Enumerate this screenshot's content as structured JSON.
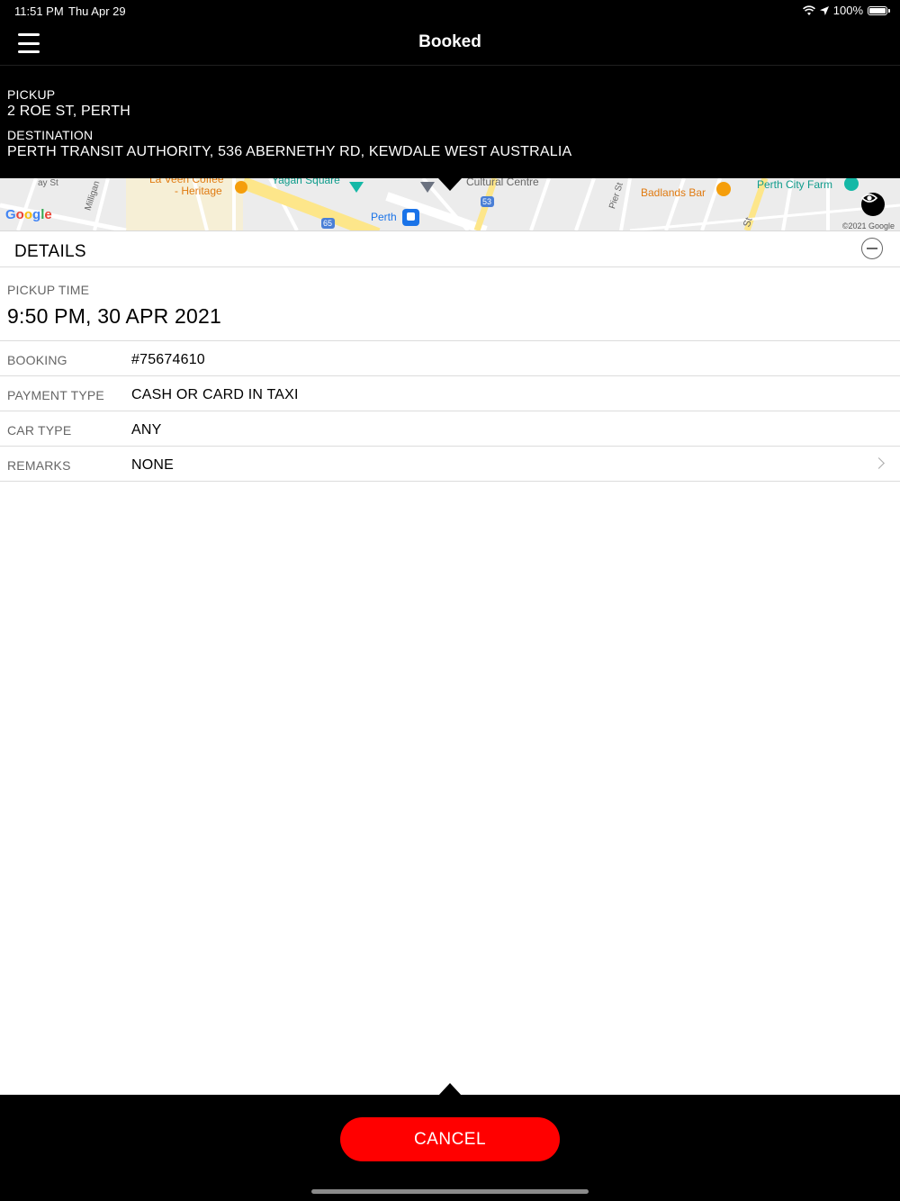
{
  "status_bar": {
    "time": "11:51 PM",
    "date": "Thu Apr 29",
    "battery": "100%",
    "battery_level": 1.0
  },
  "nav": {
    "title": "Booked"
  },
  "trip": {
    "pickup_label": "PICKUP",
    "pickup_address": "2 ROE ST, PERTH",
    "destination_label": "DESTINATION",
    "destination_address": "PERTH TRANSIT AUTHORITY, 536 ABERNETHY RD, KEWDALE  WEST AUSTRALIA"
  },
  "map": {
    "labels": {
      "street_1": "ay St",
      "street_milligan": "Milligan",
      "heritage": "- Heritage",
      "coffee": "La Veen Coffee",
      "yagan_square": "Yagan Square",
      "cultural_centre": "Cultural Centre",
      "perth": "Perth",
      "route_65": "65",
      "route_53": "53",
      "pier_st": "Pier St",
      "badlands_bar": "Badlands Bar",
      "perth_city_farm": "Perth City Farm",
      "st": "St"
    },
    "logo": "Google",
    "copyright": "©2021 Google"
  },
  "details": {
    "title": "DETAILS",
    "pickup_time_label": "PICKUP TIME",
    "pickup_time_value": "9:50 PM, 30 APR 2021",
    "rows": [
      {
        "label": "BOOKING",
        "value": "#75674610"
      },
      {
        "label": "PAYMENT TYPE",
        "value": "CASH OR CARD IN TAXI"
      },
      {
        "label": "CAR TYPE",
        "value": "ANY"
      },
      {
        "label": "REMARKS",
        "value": "NONE"
      }
    ]
  },
  "actions": {
    "cancel_label": "CANCEL"
  },
  "colors": {
    "accent": "#ff0000",
    "bar_background": "#000000",
    "map_road_yellow": "#fde68a",
    "map_poi_orange": "#f59e0b",
    "map_poi_teal": "#14b8a6",
    "map_transit_blue": "#1a73e8"
  }
}
